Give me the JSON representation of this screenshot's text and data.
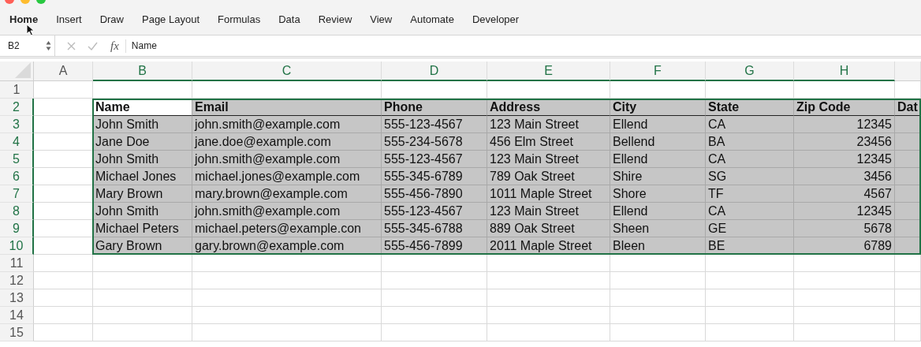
{
  "ribbon_tabs": [
    {
      "label": "Home",
      "selected": true
    },
    {
      "label": "Insert",
      "selected": false
    },
    {
      "label": "Draw",
      "selected": false
    },
    {
      "label": "Page Layout",
      "selected": false
    },
    {
      "label": "Formulas",
      "selected": false
    },
    {
      "label": "Data",
      "selected": false
    },
    {
      "label": "Review",
      "selected": false
    },
    {
      "label": "View",
      "selected": false
    },
    {
      "label": "Automate",
      "selected": false
    },
    {
      "label": "Developer",
      "selected": false
    }
  ],
  "formula_bar": {
    "name_box": "B2",
    "function_label": "fx",
    "formula": "Name"
  },
  "column_headers": [
    {
      "letter": "A",
      "selected": false
    },
    {
      "letter": "B",
      "selected": true
    },
    {
      "letter": "C",
      "selected": true
    },
    {
      "letter": "D",
      "selected": true
    },
    {
      "letter": "E",
      "selected": true
    },
    {
      "letter": "F",
      "selected": true
    },
    {
      "letter": "G",
      "selected": true
    },
    {
      "letter": "H",
      "selected": true
    }
  ],
  "row_headers": [
    {
      "number": "1",
      "selected": false
    },
    {
      "number": "2",
      "selected": true
    },
    {
      "number": "3",
      "selected": true
    },
    {
      "number": "4",
      "selected": true
    },
    {
      "number": "5",
      "selected": true
    },
    {
      "number": "6",
      "selected": true
    },
    {
      "number": "7",
      "selected": true
    },
    {
      "number": "8",
      "selected": true
    },
    {
      "number": "9",
      "selected": true
    },
    {
      "number": "10",
      "selected": true
    },
    {
      "number": "11",
      "selected": false
    },
    {
      "number": "12",
      "selected": false
    },
    {
      "number": "13",
      "selected": false
    },
    {
      "number": "14",
      "selected": false
    },
    {
      "number": "15",
      "selected": false
    }
  ],
  "table": {
    "columns": [
      {
        "header": "Name",
        "kind": "text"
      },
      {
        "header": "Email",
        "kind": "text"
      },
      {
        "header": "Phone",
        "kind": "text"
      },
      {
        "header": "Address",
        "kind": "text"
      },
      {
        "header": "City",
        "kind": "text"
      },
      {
        "header": "State",
        "kind": "text"
      },
      {
        "header": "Zip Code",
        "kind": "number"
      },
      {
        "header": "Dat",
        "kind": "text"
      }
    ],
    "rows": [
      [
        "John Smith",
        "john.smith@example.com",
        "555-123-4567",
        "123 Main Street",
        "Ellend",
        "CA",
        "12345"
      ],
      [
        "Jane Doe",
        "jane.doe@example.com",
        "555-234-5678",
        "456 Elm Street",
        "Bellend",
        "BA",
        "23456"
      ],
      [
        "John Smith",
        "john.smith@example.com",
        "555-123-4567",
        "123 Main Street",
        "Ellend",
        "CA",
        "12345"
      ],
      [
        "Michael Jones",
        "michael.jones@example.com",
        "555-345-6789",
        "789 Oak Street",
        "Shire",
        "SG",
        "3456"
      ],
      [
        "Mary Brown",
        "mary.brown@example.com",
        "555-456-7890",
        "1011 Maple Street",
        "Shore",
        "TF",
        "4567"
      ],
      [
        "John Smith",
        "john.smith@example.com",
        "555-123-4567",
        "123 Main Street",
        "Ellend",
        "CA",
        "12345"
      ],
      [
        "Michael Peters",
        "michael.peters@example.con",
        "555-345-6788",
        "889 Oak Street",
        "Sheen",
        "GE",
        "5678"
      ],
      [
        "Gary Brown",
        "gary.brown@example.com",
        "555-456-7899",
        "2011 Maple Street",
        "Bleen",
        "BE",
        "6789"
      ]
    ]
  }
}
